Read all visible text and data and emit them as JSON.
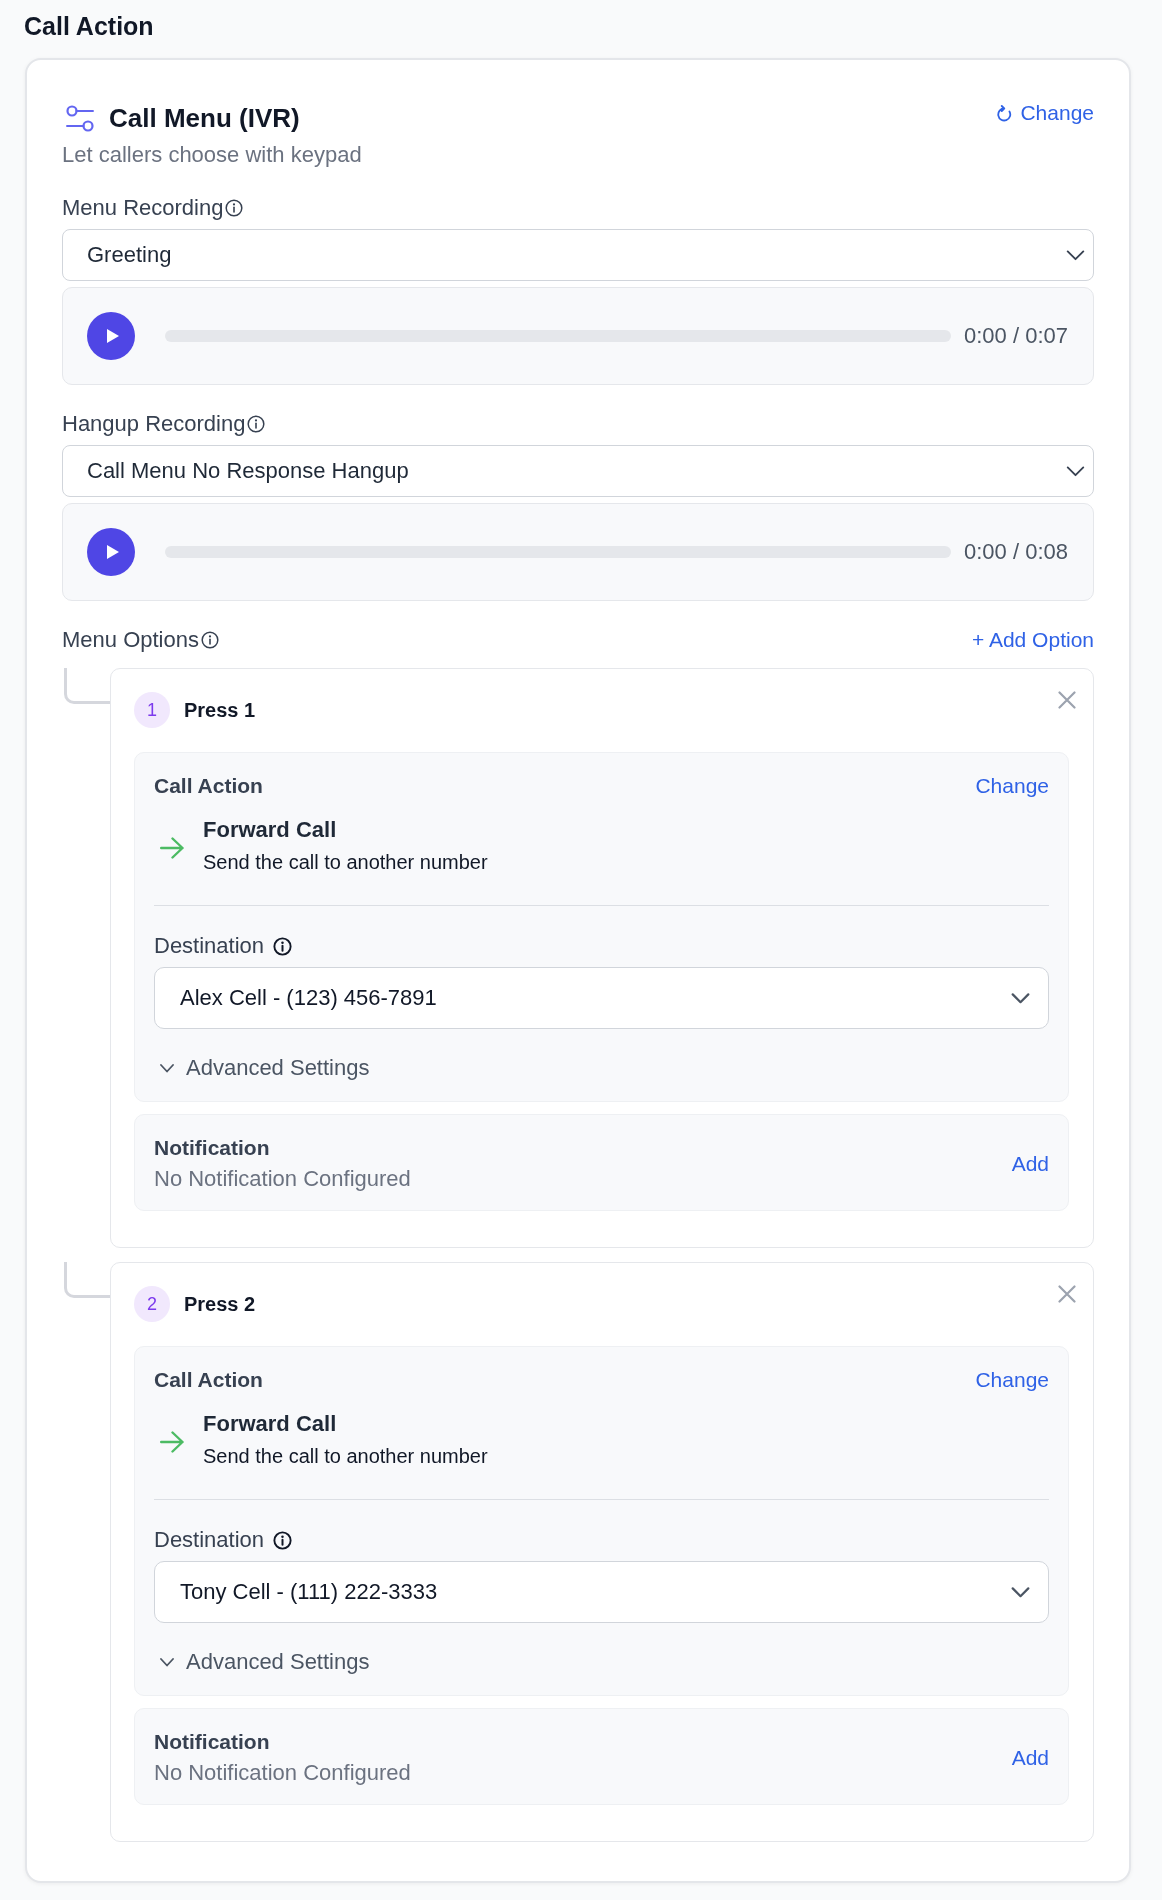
{
  "page": {
    "title": "Call Action"
  },
  "action": {
    "title": "Call Menu (IVR)",
    "subtitle": "Let callers choose with keypad",
    "change_link": "Change"
  },
  "recordings": [
    {
      "label": "Menu Recording",
      "value": "Greeting",
      "player": {
        "playing": false,
        "level": 0,
        "time": "0:00 / 0:07"
      }
    },
    {
      "label": "Hangup Recording",
      "value": "Call Menu No Response Hangup",
      "player": {
        "playing": false,
        "level": 0,
        "time": "0:00 / 0:08"
      }
    }
  ],
  "menu_options": {
    "label": "Menu Options",
    "add_link": "+ Add Option",
    "options": [
      {
        "key": "1",
        "title": "Press 1",
        "call_action": {
          "heading": "Call Action",
          "change_link": "Change",
          "name": "Forward Call",
          "description": "Send the call to another number"
        },
        "destination": {
          "label": "Destination",
          "value": "Alex Cell - (123) 456-7891"
        },
        "advanced": {
          "label": "Advanced Settings",
          "expanded": false
        },
        "notification": {
          "heading": "Notification",
          "status": "No Notification Configured",
          "add_link": "Add"
        }
      },
      {
        "key": "2",
        "title": "Press 2",
        "call_action": {
          "heading": "Call Action",
          "change_link": "Change",
          "name": "Forward Call",
          "description": "Send the call to another number"
        },
        "destination": {
          "label": "Destination",
          "value": "Tony Cell - (111) 222-3333"
        },
        "advanced": {
          "label": "Advanced Settings",
          "expanded": false
        },
        "notification": {
          "heading": "Notification",
          "status": "No Notification Configured",
          "add_link": "Add"
        }
      }
    ]
  }
}
